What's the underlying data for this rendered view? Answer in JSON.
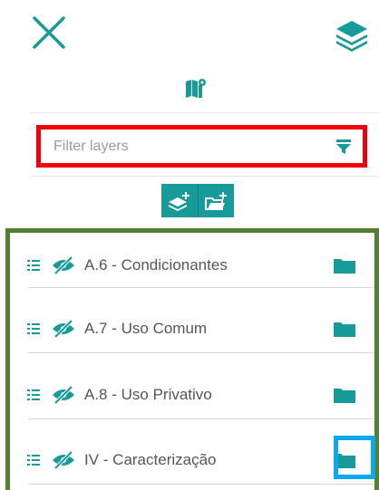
{
  "filter": {
    "placeholder": "Filter layers"
  },
  "layers": [
    {
      "label": "A.6 - Condicionantes"
    },
    {
      "label": "A.7 - Uso Comum"
    },
    {
      "label": "A.8 - Uso Privativo"
    },
    {
      "label": "IV - Caracterização"
    }
  ],
  "icons": {
    "close": "close-icon",
    "layers": "layers-icon",
    "map": "map-icon",
    "filter": "filter-icon",
    "add_layer": "add-layer-icon",
    "add_folder": "add-folder-icon",
    "drag": "drag-handle-icon",
    "hidden": "eye-slash-icon",
    "folder": "folder-icon"
  },
  "colors": {
    "accent": "#169a9a",
    "filter_highlight": "#f0000a",
    "panel_highlight": "#52802f",
    "folder_highlight": "#0aa8ef"
  }
}
